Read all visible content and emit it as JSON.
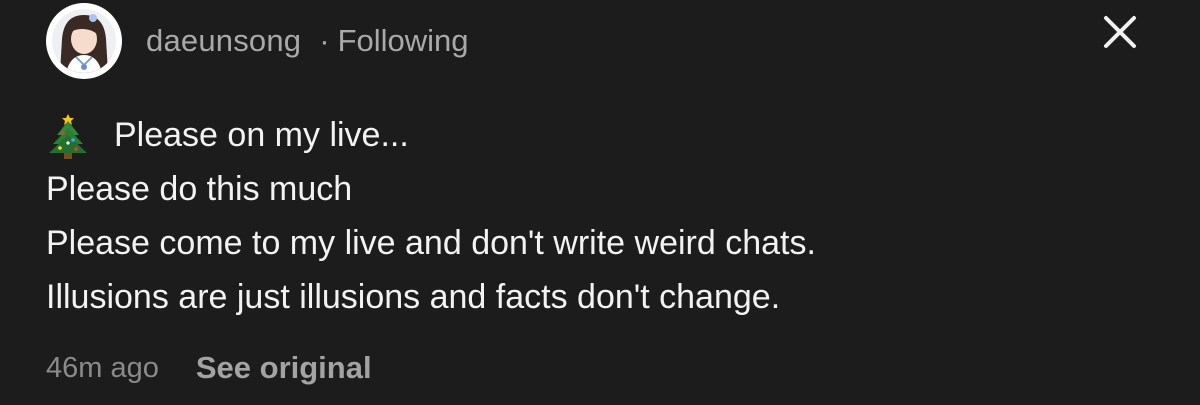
{
  "header": {
    "username": "daeunsong",
    "follow_separator": "·",
    "follow_status": "Following"
  },
  "icons": {
    "close": "close-icon",
    "avatar": "profile-avatar",
    "tree": "christmas-tree-icon"
  },
  "post": {
    "lines": [
      "Please on my live...",
      "Please do this much",
      "Please come to my live and don't write weird chats.",
      "Illusions are just illusions and facts don't change."
    ]
  },
  "footer": {
    "time": "46m ago",
    "see_original": "See original"
  },
  "colors": {
    "background": "#1c1c1c",
    "text": "#f2f2f2",
    "muted": "#a9a9a9"
  }
}
